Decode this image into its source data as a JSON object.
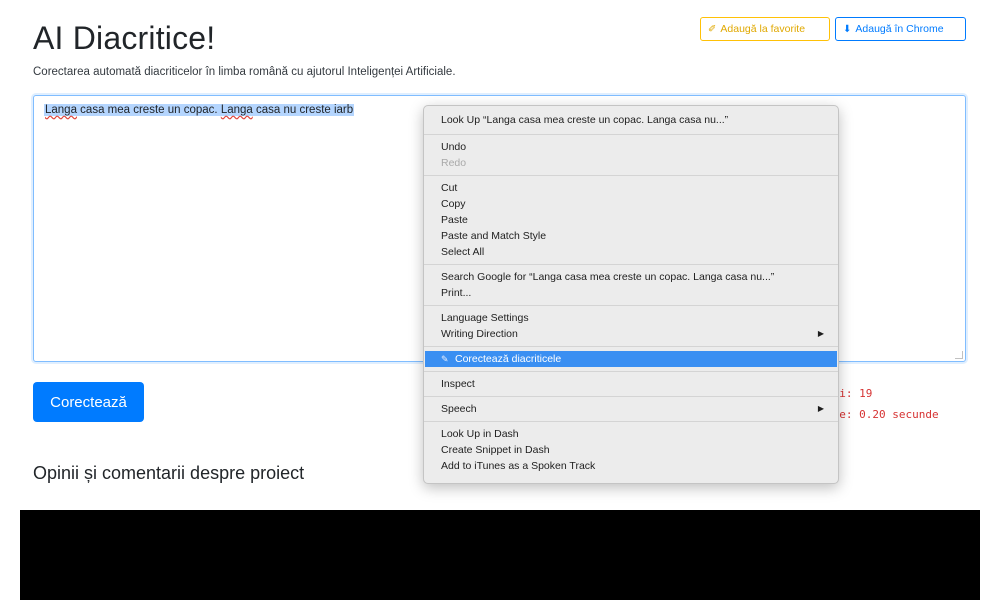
{
  "header": {
    "title": "AI Diacritice!",
    "subtitle": "Corectarea automată diacriticelor în limba română cu ajutorul Inteligenței Artificiale.",
    "favorite_button": "Adaugă la favorite",
    "favorite_icon": "✐",
    "chrome_button": "Adaugă în Chrome",
    "chrome_icon": "⬇"
  },
  "editor": {
    "word1": "Langa",
    "text1": " casa mea creste un copac. ",
    "word2": "Langa",
    "text2": " casa nu creste iarb"
  },
  "actions": {
    "correct_button": "Corectează"
  },
  "stats": {
    "line1": "eri: 19",
    "line2": "are: 0.20 secunde"
  },
  "comments": {
    "heading": "Opinii și comentarii despre proiect"
  },
  "context_menu": {
    "look_up": "Look Up “Langa casa mea creste un copac. Langa casa nu...”",
    "undo": "Undo",
    "redo": "Redo",
    "cut": "Cut",
    "copy": "Copy",
    "paste": "Paste",
    "paste_match": "Paste and Match Style",
    "select_all": "Select All",
    "search_google": "Search Google for “Langa casa mea creste un copac. Langa casa nu...”",
    "print": "Print...",
    "language_settings": "Language Settings",
    "writing_direction": "Writing Direction",
    "corecteaza": "Corectează diacriticele",
    "inspect": "Inspect",
    "speech": "Speech",
    "look_up_dash": "Look Up in Dash",
    "create_snippet": "Create Snippet in Dash",
    "add_itunes": "Add to iTunes as a Spoken Track",
    "submenu_arrow": "▶"
  },
  "colors": {
    "primary": "#007bff",
    "warning": "#ffc107",
    "menu_highlight": "#3a8ff2",
    "stat_text": "#d63333"
  }
}
